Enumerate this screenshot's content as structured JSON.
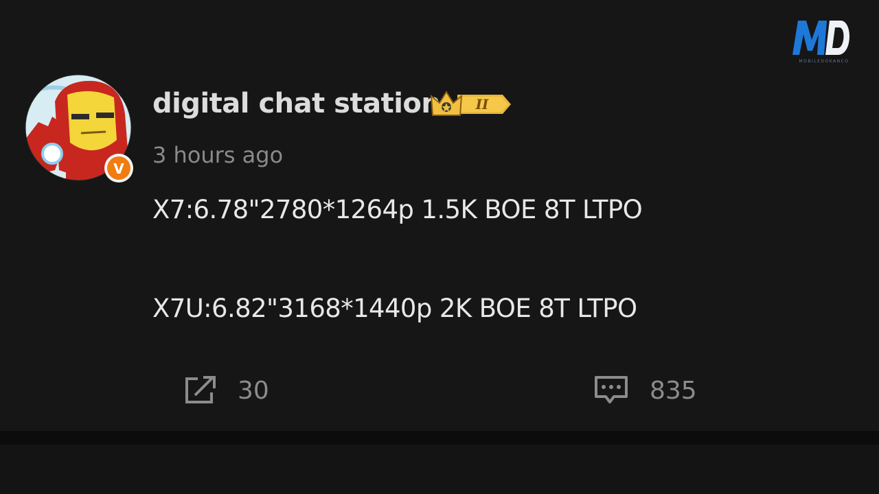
{
  "watermark": {
    "logo_letters": "MD",
    "tagline": "MOBILEDOKANCO",
    "colors": {
      "m": "#1e78d8",
      "d": "#f4f6fa"
    }
  },
  "post": {
    "author": "digital chat station",
    "level_badge": "II",
    "verified_badge": "V",
    "timestamp": "3 hours ago",
    "lines": [
      "X7:6.78\"2780*1264p 1.5K BOE 8T LTPO",
      "X7U:6.82\"3168*1440p 2K BOE 8T LTPO"
    ],
    "actions": {
      "share_icon": "share-icon",
      "share_count": "30",
      "comment_icon": "comment-icon",
      "comment_count": "835"
    }
  },
  "colors": {
    "background": "#161616",
    "text": "#e8e8e8",
    "muted": "#8a8a8a",
    "badge_orange": "#f07c12",
    "crown_gold": "#f2c040"
  }
}
